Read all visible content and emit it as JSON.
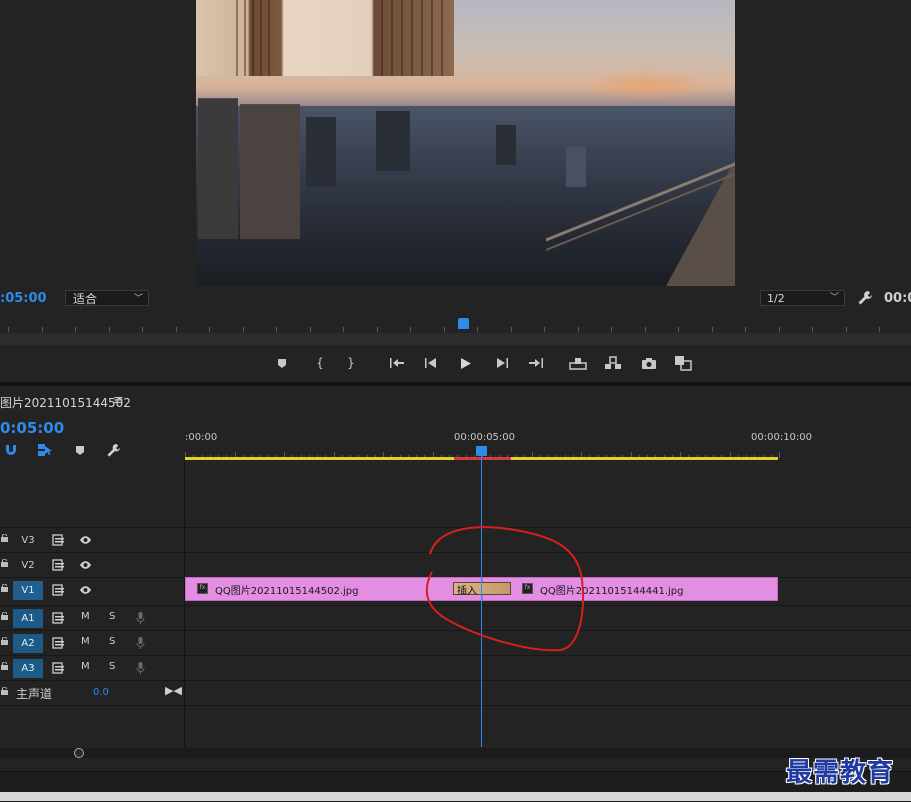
{
  "program_monitor": {
    "timecode": ":05:00",
    "fit_select": "适合",
    "resolution_select": "1/2",
    "timecode_right": "00:0"
  },
  "transport_icons": [
    "add-marker-icon",
    "mark-in-icon",
    "mark-out-icon",
    "go-to-in-icon",
    "step-back-icon",
    "play-icon",
    "step-forward-icon",
    "go-to-out-icon",
    "lift-icon",
    "extract-icon",
    "export-frame-icon",
    "compare-view-icon"
  ],
  "sequence": {
    "name": "图片20211015144502",
    "menu_glyph": "≡",
    "timecode": "0:05:00"
  },
  "ruler": {
    "labels": [
      ":00:00",
      "00:00:05:00",
      "00:00:10:00"
    ]
  },
  "tracks": {
    "video": [
      {
        "name": "V3",
        "active": false
      },
      {
        "name": "V2",
        "active": false
      },
      {
        "name": "V1",
        "active": true
      }
    ],
    "audio": [
      {
        "name": "A1",
        "mute": "M",
        "solo": "S"
      },
      {
        "name": "A2",
        "mute": "M",
        "solo": "S"
      },
      {
        "name": "A3",
        "mute": "M",
        "solo": "S"
      }
    ],
    "master": {
      "label": "主声道",
      "value": "0.0"
    }
  },
  "clips": {
    "clip1": "QQ图片20211015144502.jpg",
    "clip2": "QQ图片20211015144441.jpg",
    "insert_label": "插入"
  },
  "colors": {
    "accent": "#2d8ceb",
    "clip": "#e48ee3",
    "work_area": "#e0d223",
    "annotation": "#d42020"
  },
  "watermark": "最需教育"
}
